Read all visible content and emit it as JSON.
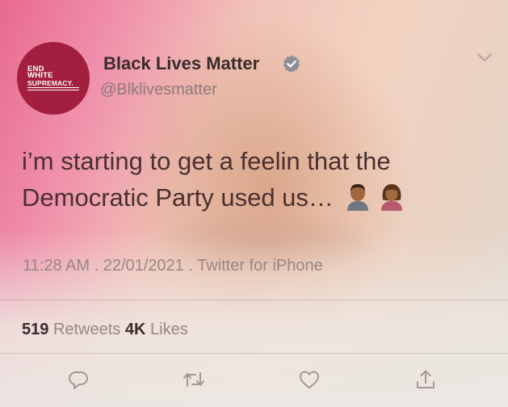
{
  "tweet": {
    "avatar_lines": [
      "END",
      "WHITE",
      "SUPREMACY."
    ],
    "display_name": "Black Lives Matter",
    "handle": "@Blklivesmatter",
    "text": "i’m starting to get a feelin that the Democratic Party used us…",
    "emojis": [
      "man-emoji",
      "woman-emoji"
    ],
    "time": "11:28 AM",
    "date": "22/01/2021",
    "source": "Twitter for iPhone",
    "retweets_count": "519",
    "retweets_label": "Retweets",
    "likes_count": "4K",
    "likes_label": "Likes"
  },
  "icons": {
    "verified": "verified-badge-icon",
    "more": "chevron-down-icon",
    "reply": "reply-icon",
    "retweet": "retweet-icon",
    "like": "heart-icon",
    "share": "share-icon"
  },
  "colors": {
    "avatar_bg": "#a31f3f",
    "verified": "#8d8f94",
    "text": "#4a3030",
    "muted": "#9a8585"
  }
}
